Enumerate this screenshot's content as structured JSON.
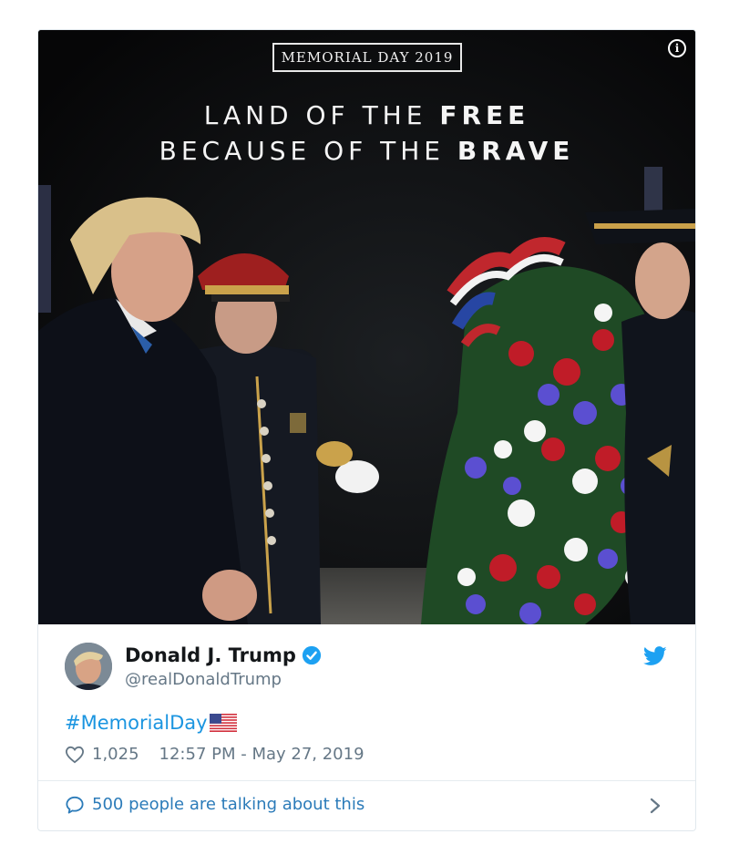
{
  "media": {
    "badge_text": "MEMORIAL DAY 2019",
    "headline_line1_plain": "LAND OF THE ",
    "headline_line1_bold": "FREE",
    "headline_line2_plain": "BECAUSE OF THE ",
    "headline_line2_bold": "BRAVE",
    "info_icon": "i"
  },
  "author": {
    "display_name": "Donald J. Trump",
    "handle": "@realDonaldTrump",
    "verified": true
  },
  "tweet": {
    "text": "#MemorialDay",
    "likes": "1,025",
    "timestamp": "12:57 PM - May 27, 2019"
  },
  "footer": {
    "talking_text": "500 people are talking about this"
  },
  "colors": {
    "twitter_blue": "#1da1f2",
    "link_blue": "#1b95e0",
    "footer_blue": "#2b7bb9",
    "muted": "#657786"
  }
}
